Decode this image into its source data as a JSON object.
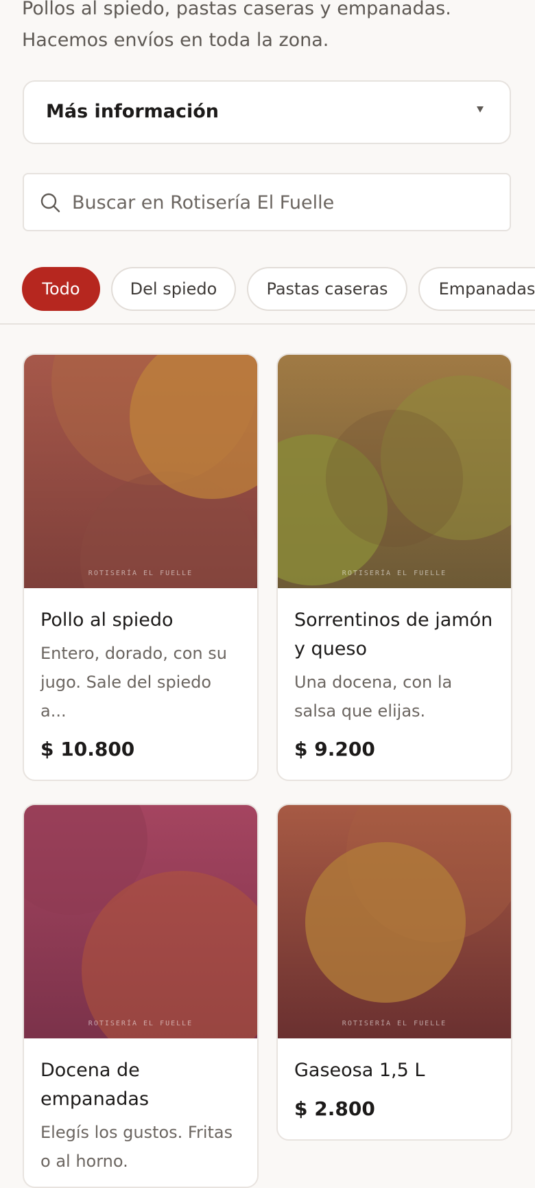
{
  "intro": {
    "line1": "Pollos al spiedo, pastas caseras y empanadas.",
    "line2": "Hacemos envíos en toda la zona."
  },
  "more_info": {
    "label": "Más información"
  },
  "search": {
    "placeholder": "Buscar en Rotisería El Fuelle"
  },
  "categories": [
    {
      "label": "Todo",
      "active": true
    },
    {
      "label": "Del spiedo",
      "active": false
    },
    {
      "label": "Pastas caseras",
      "active": false
    },
    {
      "label": "Empanadas",
      "active": false
    }
  ],
  "colors": {
    "accent": "#b6271f",
    "background": "#faf8f6",
    "card_border": "#e8e3df"
  },
  "products": [
    {
      "title": "Pollo al spiedo",
      "description": "Entero, dorado, con su jugo. Sale del spiedo a...",
      "price": "$ 10.800",
      "brand": "ROTISERÍA EL FUELLE",
      "image_colors": [
        "#a6584a",
        "#7e3f3a",
        "#c0843a"
      ]
    },
    {
      "title": "Sorrentinos de jamón y queso",
      "description": "Una docena, con la salsa que elijas.",
      "price": "$ 9.200",
      "brand": "ROTISERÍA EL FUELLE",
      "image_colors": [
        "#a07a44",
        "#6d5a36",
        "#8f8a3a"
      ]
    },
    {
      "title": "Docena de empanadas",
      "description": "Elegís los gustos. Fritas o al horno.",
      "price": "",
      "brand": "ROTISERÍA EL FUELLE",
      "image_colors": [
        "#a54560",
        "#7b324a",
        "#b0553a"
      ]
    },
    {
      "title": "Gaseosa 1,5 L",
      "description": "",
      "price": "$ 2.800",
      "brand": "ROTISERÍA EL FUELLE",
      "image_colors": [
        "#a75a44",
        "#6a3030",
        "#b07a3a"
      ]
    }
  ]
}
